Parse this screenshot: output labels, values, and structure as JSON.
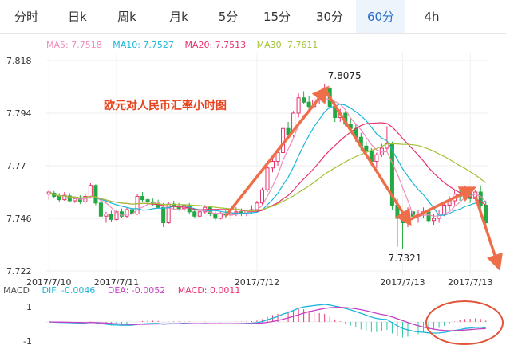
{
  "tabs": [
    {
      "label": "分时",
      "active": false
    },
    {
      "label": "日k",
      "active": false
    },
    {
      "label": "周k",
      "active": false
    },
    {
      "label": "月k",
      "active": false
    },
    {
      "label": "5分",
      "active": false
    },
    {
      "label": "15分",
      "active": false
    },
    {
      "label": "30分",
      "active": false
    },
    {
      "label": "60分",
      "active": true
    },
    {
      "label": "4h",
      "active": false
    }
  ],
  "ma_legend": [
    {
      "label": "MA5: 7.7518",
      "color": "#f08cbd"
    },
    {
      "label": "MA10: 7.7527",
      "color": "#1ab6d9"
    },
    {
      "label": "MA20: 7.7513",
      "color": "#e8336d"
    },
    {
      "label": "MA30: 7.7611",
      "color": "#a2c232"
    }
  ],
  "macd_legend": {
    "name": "MACD",
    "dif": {
      "label": "DIF: -0.0046",
      "color": "#1ab6d9"
    },
    "dea": {
      "label": "DEA: -0.0052",
      "color": "#c63fc5"
    },
    "macd": {
      "label": "MACD: 0.0011",
      "color": "#e8336d"
    }
  },
  "annotation": {
    "text": "欧元对人民币汇率小时图",
    "color": "#e8441f"
  },
  "colors": {
    "up": "#e8336d",
    "down": "#22a943",
    "arrow": "#ef6e4a",
    "circle": "#e0563a"
  },
  "chart_data": {
    "type": "candlestick",
    "y_ticks": [
      "7.818",
      "7.794",
      "7.77",
      "7.746",
      "7.722"
    ],
    "y_tick_values": [
      7.818,
      7.794,
      7.77,
      7.746,
      7.722
    ],
    "ylim": [
      7.722,
      7.818
    ],
    "x_ticks": [
      "2017/7/10",
      "2017/7/11",
      "2017/7/12",
      "2017/7/13",
      "2017/7/13"
    ],
    "x_tick_indices": [
      0,
      13,
      40,
      68,
      81
    ],
    "high_label": "7.8075",
    "low_label": "7.7321",
    "candles": [
      [
        7.757,
        7.759,
        7.7545,
        7.758
      ],
      [
        7.7575,
        7.7585,
        7.755,
        7.756
      ],
      [
        7.756,
        7.7575,
        7.7535,
        7.7545
      ],
      [
        7.7545,
        7.758,
        7.754,
        7.7565
      ],
      [
        7.7562,
        7.7575,
        7.7535,
        7.754
      ],
      [
        7.754,
        7.756,
        7.753,
        7.755
      ],
      [
        7.755,
        7.7565,
        7.7525,
        7.7535
      ],
      [
        7.7535,
        7.757,
        7.753,
        7.756
      ],
      [
        7.756,
        7.762,
        7.755,
        7.761
      ],
      [
        7.761,
        7.7615,
        7.752,
        7.753
      ],
      [
        7.753,
        7.754,
        7.746,
        7.747
      ],
      [
        7.747,
        7.749,
        7.744,
        7.748
      ],
      [
        7.748,
        7.7495,
        7.7445,
        7.7455
      ],
      [
        7.7455,
        7.75,
        7.745,
        7.749
      ],
      [
        7.749,
        7.7505,
        7.746,
        7.747
      ],
      [
        7.747,
        7.751,
        7.746,
        7.75
      ],
      [
        7.75,
        7.752,
        7.747,
        7.748
      ],
      [
        7.748,
        7.757,
        7.7475,
        7.756
      ],
      [
        7.756,
        7.758,
        7.7535,
        7.7545
      ],
      [
        7.7545,
        7.7555,
        7.752,
        7.7535
      ],
      [
        7.7535,
        7.755,
        7.7515,
        7.7525
      ],
      [
        7.7525,
        7.7545,
        7.7505,
        7.751
      ],
      [
        7.751,
        7.753,
        7.742,
        7.744
      ],
      [
        7.744,
        7.7535,
        7.7435,
        7.7525
      ],
      [
        7.7525,
        7.754,
        7.75,
        7.7515
      ],
      [
        7.7515,
        7.753,
        7.7495,
        7.7505
      ],
      [
        7.7505,
        7.7525,
        7.749,
        7.752
      ],
      [
        7.752,
        7.753,
        7.748,
        7.749
      ],
      [
        7.749,
        7.7505,
        7.746,
        7.747
      ],
      [
        7.747,
        7.75,
        7.746,
        7.749
      ],
      [
        7.749,
        7.752,
        7.748,
        7.751
      ],
      [
        7.751,
        7.7515,
        7.747,
        7.748
      ],
      [
        7.748,
        7.7495,
        7.745,
        7.746
      ],
      [
        7.746,
        7.749,
        7.7455,
        7.748
      ],
      [
        7.748,
        7.75,
        7.746,
        7.7475
      ],
      [
        7.7475,
        7.749,
        7.7455,
        7.7485
      ],
      [
        7.7485,
        7.751,
        7.747,
        7.749
      ],
      [
        7.749,
        7.7505,
        7.747,
        7.748
      ],
      [
        7.748,
        7.75,
        7.747,
        7.7495
      ],
      [
        7.7495,
        7.752,
        7.748,
        7.75
      ],
      [
        7.75,
        7.754,
        7.749,
        7.753
      ],
      [
        7.753,
        7.76,
        7.752,
        7.759
      ],
      [
        7.759,
        7.77,
        7.758,
        7.769
      ],
      [
        7.769,
        7.774,
        7.767,
        7.772
      ],
      [
        7.772,
        7.778,
        7.77,
        7.776
      ],
      [
        7.776,
        7.788,
        7.775,
        7.787
      ],
      [
        7.787,
        7.79,
        7.782,
        7.784
      ],
      [
        7.784,
        7.795,
        7.783,
        7.794
      ],
      [
        7.794,
        7.803,
        7.792,
        7.801
      ],
      [
        7.801,
        7.804,
        7.798,
        7.799
      ],
      [
        7.799,
        7.802,
        7.795,
        7.797
      ],
      [
        7.797,
        7.801,
        7.796,
        7.8
      ],
      [
        7.8,
        7.804,
        7.798,
        7.802
      ],
      [
        7.802,
        7.8075,
        7.8,
        7.8055
      ],
      [
        7.8055,
        7.8065,
        7.796,
        7.797
      ],
      [
        7.797,
        7.799,
        7.79,
        7.792
      ],
      [
        7.792,
        7.796,
        7.79,
        7.794
      ],
      [
        7.794,
        7.795,
        7.788,
        7.789
      ],
      [
        7.789,
        7.792,
        7.785,
        7.787
      ],
      [
        7.787,
        7.789,
        7.781,
        7.783
      ],
      [
        7.783,
        7.785,
        7.777,
        7.779
      ],
      [
        7.779,
        7.781,
        7.774,
        7.777
      ],
      [
        7.777,
        7.778,
        7.77,
        7.772
      ],
      [
        7.772,
        7.776,
        7.769,
        7.775
      ],
      [
        7.775,
        7.78,
        7.774,
        7.778
      ],
      [
        7.778,
        7.788,
        7.777,
        7.78
      ],
      [
        7.78,
        7.781,
        7.75,
        7.752
      ],
      [
        7.752,
        7.755,
        7.733,
        7.746
      ],
      [
        7.746,
        7.748,
        7.7321,
        7.744
      ],
      [
        7.744,
        7.751,
        7.742,
        7.749
      ],
      [
        7.749,
        7.752,
        7.745,
        7.747
      ],
      [
        7.747,
        7.75,
        7.744,
        7.748
      ],
      [
        7.748,
        7.751,
        7.746,
        7.749
      ],
      [
        7.749,
        7.75,
        7.744,
        7.745
      ],
      [
        7.745,
        7.748,
        7.743,
        7.746
      ],
      [
        7.746,
        7.75,
        7.744,
        7.748
      ],
      [
        7.748,
        7.753,
        7.747,
        7.752
      ],
      [
        7.752,
        7.756,
        7.75,
        7.754
      ],
      [
        7.754,
        7.759,
        7.752,
        7.757
      ],
      [
        7.757,
        7.76,
        7.754,
        7.756
      ],
      [
        7.756,
        7.761,
        7.755,
        7.759
      ],
      [
        7.759,
        7.76,
        7.753,
        7.755
      ],
      [
        7.755,
        7.759,
        7.754,
        7.758
      ],
      [
        7.758,
        7.761,
        7.75,
        7.752
      ],
      [
        7.752,
        7.754,
        7.743,
        7.744
      ]
    ],
    "macd_ticks": [
      "1",
      "-1"
    ]
  }
}
